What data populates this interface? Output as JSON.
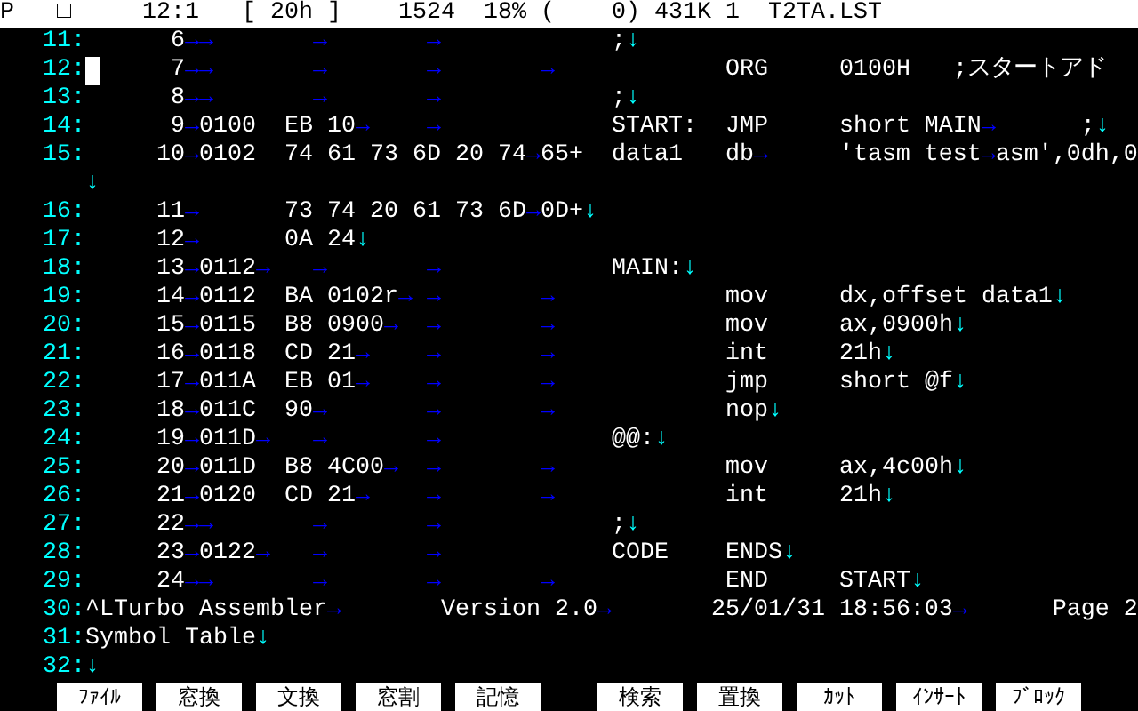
{
  "status_bar": {
    "fields": [
      "P",
      "□",
      "12:1",
      "[ 20h ]",
      "1524",
      "18%",
      "(    0)",
      "431K",
      "1",
      "T2TA.LST"
    ]
  },
  "rows": [
    {
      "number": "11:",
      "cursor": false,
      "segments": [
        {
          "kind": "text",
          "text": "      6"
        },
        {
          "kind": "tab",
          "text": "→"
        },
        {
          "kind": "tab",
          "text": "→"
        },
        {
          "kind": "tab",
          "text": "→"
        },
        {
          "kind": "tab",
          "text": "→"
        },
        {
          "kind": "text",
          "text": "     ;"
        },
        {
          "kind": "eol",
          "text": "↓"
        }
      ]
    },
    {
      "number": "12:",
      "cursor": true,
      "segments": [
        {
          "kind": "text",
          "text": "      7"
        },
        {
          "kind": "tab",
          "text": "→"
        },
        {
          "kind": "tab",
          "text": "→"
        },
        {
          "kind": "tab",
          "text": "→"
        },
        {
          "kind": "tab",
          "text": "→"
        },
        {
          "kind": "tab",
          "text": "→"
        },
        {
          "kind": "text",
          "text": "     ORG     0100H   ;スタートアド"
        }
      ]
    },
    {
      "number": "13:",
      "cursor": false,
      "segments": [
        {
          "kind": "text",
          "text": "      8"
        },
        {
          "kind": "tab",
          "text": "→"
        },
        {
          "kind": "tab",
          "text": "→"
        },
        {
          "kind": "tab",
          "text": "→"
        },
        {
          "kind": "tab",
          "text": "→"
        },
        {
          "kind": "text",
          "text": "     ;"
        },
        {
          "kind": "eol",
          "text": "↓"
        }
      ]
    },
    {
      "number": "14:",
      "cursor": false,
      "segments": [
        {
          "kind": "text",
          "text": "      9"
        },
        {
          "kind": "tab",
          "text": "→"
        },
        {
          "kind": "text",
          "text": "0100  EB 10"
        },
        {
          "kind": "tab",
          "text": "→"
        },
        {
          "kind": "tab",
          "text": "→"
        },
        {
          "kind": "text",
          "text": "     START:  JMP     short MAIN"
        },
        {
          "kind": "tab",
          "text": "→"
        },
        {
          "kind": "text",
          "text": "      ;"
        },
        {
          "kind": "eol",
          "text": "↓"
        }
      ]
    },
    {
      "number": "15:",
      "cursor": false,
      "segments": [
        {
          "kind": "text",
          "text": "     10"
        },
        {
          "kind": "tab",
          "text": "→"
        },
        {
          "kind": "text",
          "text": "0102  74 61 73 6D 20 74"
        },
        {
          "kind": "tab",
          "text": "→"
        },
        {
          "kind": "text",
          "text": "65+  data1   db"
        },
        {
          "kind": "tab",
          "text": "→"
        },
        {
          "kind": "text",
          "text": "     'tasm test"
        },
        {
          "kind": "tab",
          "text": "→"
        },
        {
          "kind": "text",
          "text": "asm',0dh,0"
        }
      ]
    },
    {
      "cursor": false,
      "segments": [
        {
          "kind": "eol",
          "text": "↓"
        }
      ]
    },
    {
      "number": "16:",
      "cursor": false,
      "segments": [
        {
          "kind": "text",
          "text": "     11"
        },
        {
          "kind": "tab",
          "text": "→"
        },
        {
          "kind": "text",
          "text": "      73 74 20 61 73 6D"
        },
        {
          "kind": "tab",
          "text": "→"
        },
        {
          "kind": "text",
          "text": "0D+"
        },
        {
          "kind": "eol",
          "text": "↓"
        }
      ]
    },
    {
      "number": "17:",
      "cursor": false,
      "segments": [
        {
          "kind": "text",
          "text": "     12"
        },
        {
          "kind": "tab",
          "text": "→"
        },
        {
          "kind": "text",
          "text": "      0A 24"
        },
        {
          "kind": "eol",
          "text": "↓"
        }
      ]
    },
    {
      "number": "18:",
      "cursor": false,
      "segments": [
        {
          "kind": "text",
          "text": "     13"
        },
        {
          "kind": "tab",
          "text": "→"
        },
        {
          "kind": "text",
          "text": "0112"
        },
        {
          "kind": "tab",
          "text": "→"
        },
        {
          "kind": "tab",
          "text": "→"
        },
        {
          "kind": "tab",
          "text": "→"
        },
        {
          "kind": "text",
          "text": "     MAIN:"
        },
        {
          "kind": "eol",
          "text": "↓"
        }
      ]
    },
    {
      "number": "19:",
      "cursor": false,
      "segments": [
        {
          "kind": "text",
          "text": "     14"
        },
        {
          "kind": "tab",
          "text": "→"
        },
        {
          "kind": "text",
          "text": "0112  BA 0102r"
        },
        {
          "kind": "tab",
          "text": "→"
        },
        {
          "kind": "tab",
          "text": "→"
        },
        {
          "kind": "tab",
          "text": "→"
        },
        {
          "kind": "text",
          "text": "     mov     dx,offset data1"
        },
        {
          "kind": "eol",
          "text": "↓"
        }
      ]
    },
    {
      "number": "20:",
      "cursor": false,
      "segments": [
        {
          "kind": "text",
          "text": "     15"
        },
        {
          "kind": "tab",
          "text": "→"
        },
        {
          "kind": "text",
          "text": "0115  B8 0900"
        },
        {
          "kind": "tab",
          "text": "→"
        },
        {
          "kind": "tab",
          "text": "→"
        },
        {
          "kind": "tab",
          "text": "→"
        },
        {
          "kind": "text",
          "text": "     mov     ax,0900h"
        },
        {
          "kind": "eol",
          "text": "↓"
        }
      ]
    },
    {
      "number": "21:",
      "cursor": false,
      "segments": [
        {
          "kind": "text",
          "text": "     16"
        },
        {
          "kind": "tab",
          "text": "→"
        },
        {
          "kind": "text",
          "text": "0118  CD 21"
        },
        {
          "kind": "tab",
          "text": "→"
        },
        {
          "kind": "tab",
          "text": "→"
        },
        {
          "kind": "tab",
          "text": "→"
        },
        {
          "kind": "text",
          "text": "     int     21h"
        },
        {
          "kind": "eol",
          "text": "↓"
        }
      ]
    },
    {
      "number": "22:",
      "cursor": false,
      "segments": [
        {
          "kind": "text",
          "text": "     17"
        },
        {
          "kind": "tab",
          "text": "→"
        },
        {
          "kind": "text",
          "text": "011A  EB 01"
        },
        {
          "kind": "tab",
          "text": "→"
        },
        {
          "kind": "tab",
          "text": "→"
        },
        {
          "kind": "tab",
          "text": "→"
        },
        {
          "kind": "text",
          "text": "     jmp     short @f"
        },
        {
          "kind": "eol",
          "text": "↓"
        }
      ]
    },
    {
      "number": "23:",
      "cursor": false,
      "segments": [
        {
          "kind": "text",
          "text": "     18"
        },
        {
          "kind": "tab",
          "text": "→"
        },
        {
          "kind": "text",
          "text": "011C  90"
        },
        {
          "kind": "tab",
          "text": "→"
        },
        {
          "kind": "tab",
          "text": "→"
        },
        {
          "kind": "tab",
          "text": "→"
        },
        {
          "kind": "text",
          "text": "     nop"
        },
        {
          "kind": "eol",
          "text": "↓"
        }
      ]
    },
    {
      "number": "24:",
      "cursor": false,
      "segments": [
        {
          "kind": "text",
          "text": "     19"
        },
        {
          "kind": "tab",
          "text": "→"
        },
        {
          "kind": "text",
          "text": "011D"
        },
        {
          "kind": "tab",
          "text": "→"
        },
        {
          "kind": "tab",
          "text": "→"
        },
        {
          "kind": "tab",
          "text": "→"
        },
        {
          "kind": "text",
          "text": "     @@:"
        },
        {
          "kind": "eol",
          "text": "↓"
        }
      ]
    },
    {
      "number": "25:",
      "cursor": false,
      "segments": [
        {
          "kind": "text",
          "text": "     20"
        },
        {
          "kind": "tab",
          "text": "→"
        },
        {
          "kind": "text",
          "text": "011D  B8 4C00"
        },
        {
          "kind": "tab",
          "text": "→"
        },
        {
          "kind": "tab",
          "text": "→"
        },
        {
          "kind": "tab",
          "text": "→"
        },
        {
          "kind": "text",
          "text": "     mov     ax,4c00h"
        },
        {
          "kind": "eol",
          "text": "↓"
        }
      ]
    },
    {
      "number": "26:",
      "cursor": false,
      "segments": [
        {
          "kind": "text",
          "text": "     21"
        },
        {
          "kind": "tab",
          "text": "→"
        },
        {
          "kind": "text",
          "text": "0120  CD 21"
        },
        {
          "kind": "tab",
          "text": "→"
        },
        {
          "kind": "tab",
          "text": "→"
        },
        {
          "kind": "tab",
          "text": "→"
        },
        {
          "kind": "text",
          "text": "     int     21h"
        },
        {
          "kind": "eol",
          "text": "↓"
        }
      ]
    },
    {
      "number": "27:",
      "cursor": false,
      "segments": [
        {
          "kind": "text",
          "text": "     22"
        },
        {
          "kind": "tab",
          "text": "→"
        },
        {
          "kind": "tab",
          "text": "→"
        },
        {
          "kind": "tab",
          "text": "→"
        },
        {
          "kind": "tab",
          "text": "→"
        },
        {
          "kind": "text",
          "text": "     ;"
        },
        {
          "kind": "eol",
          "text": "↓"
        }
      ]
    },
    {
      "number": "28:",
      "cursor": false,
      "segments": [
        {
          "kind": "text",
          "text": "     23"
        },
        {
          "kind": "tab",
          "text": "→"
        },
        {
          "kind": "text",
          "text": "0122"
        },
        {
          "kind": "tab",
          "text": "→"
        },
        {
          "kind": "tab",
          "text": "→"
        },
        {
          "kind": "tab",
          "text": "→"
        },
        {
          "kind": "text",
          "text": "     CODE    ENDS"
        },
        {
          "kind": "eol",
          "text": "↓"
        }
      ]
    },
    {
      "number": "29:",
      "cursor": false,
      "segments": [
        {
          "kind": "text",
          "text": "     24"
        },
        {
          "kind": "tab",
          "text": "→"
        },
        {
          "kind": "tab",
          "text": "→"
        },
        {
          "kind": "tab",
          "text": "→"
        },
        {
          "kind": "tab",
          "text": "→"
        },
        {
          "kind": "tab",
          "text": "→"
        },
        {
          "kind": "text",
          "text": "     END     START"
        },
        {
          "kind": "eol",
          "text": "↓"
        }
      ]
    },
    {
      "number": "30:",
      "cursor": false,
      "segments": [
        {
          "kind": "text",
          "text": "^LTurbo Assembler"
        },
        {
          "kind": "tab",
          "text": "→"
        },
        {
          "kind": "text",
          "text": " Version 2.0"
        },
        {
          "kind": "tab",
          "text": "→"
        },
        {
          "kind": "text",
          "text": "    25/01/31 18:56:03"
        },
        {
          "kind": "tab",
          "text": "→"
        },
        {
          "kind": "text",
          "text": "    Page 2"
        }
      ]
    },
    {
      "number": "31:",
      "cursor": false,
      "segments": [
        {
          "kind": "text",
          "text": "Symbol Table"
        },
        {
          "kind": "eol",
          "text": "↓"
        }
      ]
    },
    {
      "number": "32:",
      "cursor": false,
      "segments": [
        {
          "kind": "eol",
          "text": "↓"
        }
      ]
    }
  ],
  "function_key_groups": [
    {
      "keys": [
        "ﾌｧｲﾙ",
        "窓換",
        "文換",
        "窓割",
        "記憶"
      ]
    },
    {
      "keys": [
        "検索",
        "置換",
        "ｶｯﾄ",
        "ｲﾝｻｰﾄ",
        "ﾌﾞﾛｯｸ"
      ]
    }
  ]
}
